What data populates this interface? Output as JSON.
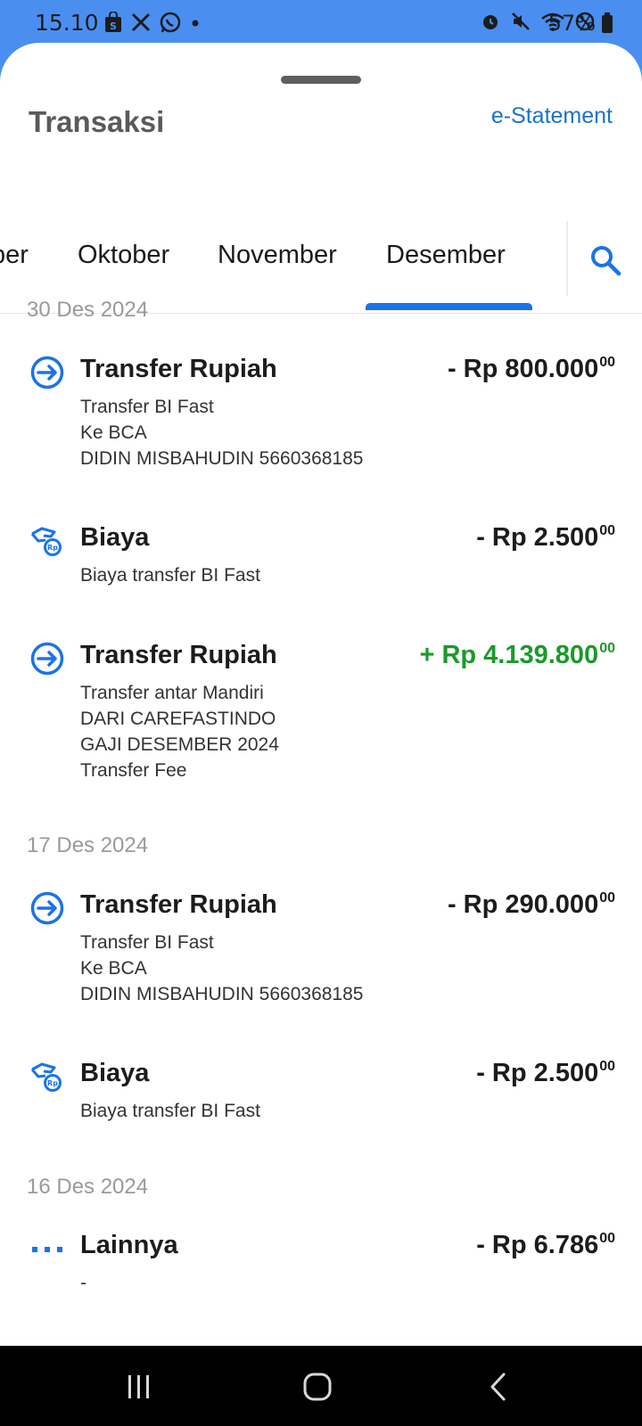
{
  "status_bar": {
    "time": "15.10",
    "battery": "57%",
    "icons_left": [
      "shop-icon",
      "x-icon",
      "whatsapp-icon",
      "dot-icon"
    ],
    "icons_right": [
      "alarm-icon",
      "mute-icon",
      "wifi-icon",
      "dnd-icon",
      "battery-icon"
    ]
  },
  "header": {
    "title": "Transaksi",
    "estatement": "e-Statement"
  },
  "tabs": [
    {
      "label": "September",
      "partial_text": "ber"
    },
    {
      "label": "Oktober"
    },
    {
      "label": "November"
    },
    {
      "label": "Desember",
      "selected": true
    }
  ],
  "groups": [
    {
      "date": "30 Des 2024",
      "transactions": [
        {
          "icon": "transfer-icon",
          "title": "Transfer Rupiah",
          "details": [
            "Transfer BI Fast",
            "Ke BCA",
            "DIDIN MISBAHUDIN 5660368185"
          ],
          "amount": "- Rp 800.000",
          "cents": "00",
          "type": "debit"
        },
        {
          "icon": "fee-icon",
          "title": "Biaya",
          "details": [
            "Biaya transfer BI Fast"
          ],
          "amount": "- Rp 2.500",
          "cents": "00",
          "type": "debit"
        },
        {
          "icon": "transfer-icon",
          "title": "Transfer Rupiah",
          "details": [
            "Transfer antar Mandiri",
            "DARI CAREFASTINDO",
            "GAJI DESEMBER 2024",
            "Transfer Fee"
          ],
          "amount": "+ Rp 4.139.800",
          "cents": "00",
          "type": "credit"
        }
      ]
    },
    {
      "date": "17 Des 2024",
      "transactions": [
        {
          "icon": "transfer-icon",
          "title": "Transfer Rupiah",
          "details": [
            "Transfer BI Fast",
            "Ke BCA",
            "DIDIN MISBAHUDIN 5660368185"
          ],
          "amount": "- Rp 290.000",
          "cents": "00",
          "type": "debit"
        },
        {
          "icon": "fee-icon",
          "title": "Biaya",
          "details": [
            "Biaya transfer BI Fast"
          ],
          "amount": "- Rp 2.500",
          "cents": "00",
          "type": "debit"
        }
      ]
    },
    {
      "date": "16 Des 2024",
      "transactions": [
        {
          "icon": "more-icon",
          "title": "Lainnya",
          "details": [
            "-"
          ],
          "amount": "- Rp 6.786",
          "cents": "00",
          "type": "debit"
        }
      ]
    }
  ],
  "colors": {
    "accent": "#1a73e8",
    "credit": "#1a9a2a",
    "status_bar": "#4a8ff0"
  },
  "nav": [
    "recent-apps-button",
    "home-button",
    "back-button"
  ]
}
